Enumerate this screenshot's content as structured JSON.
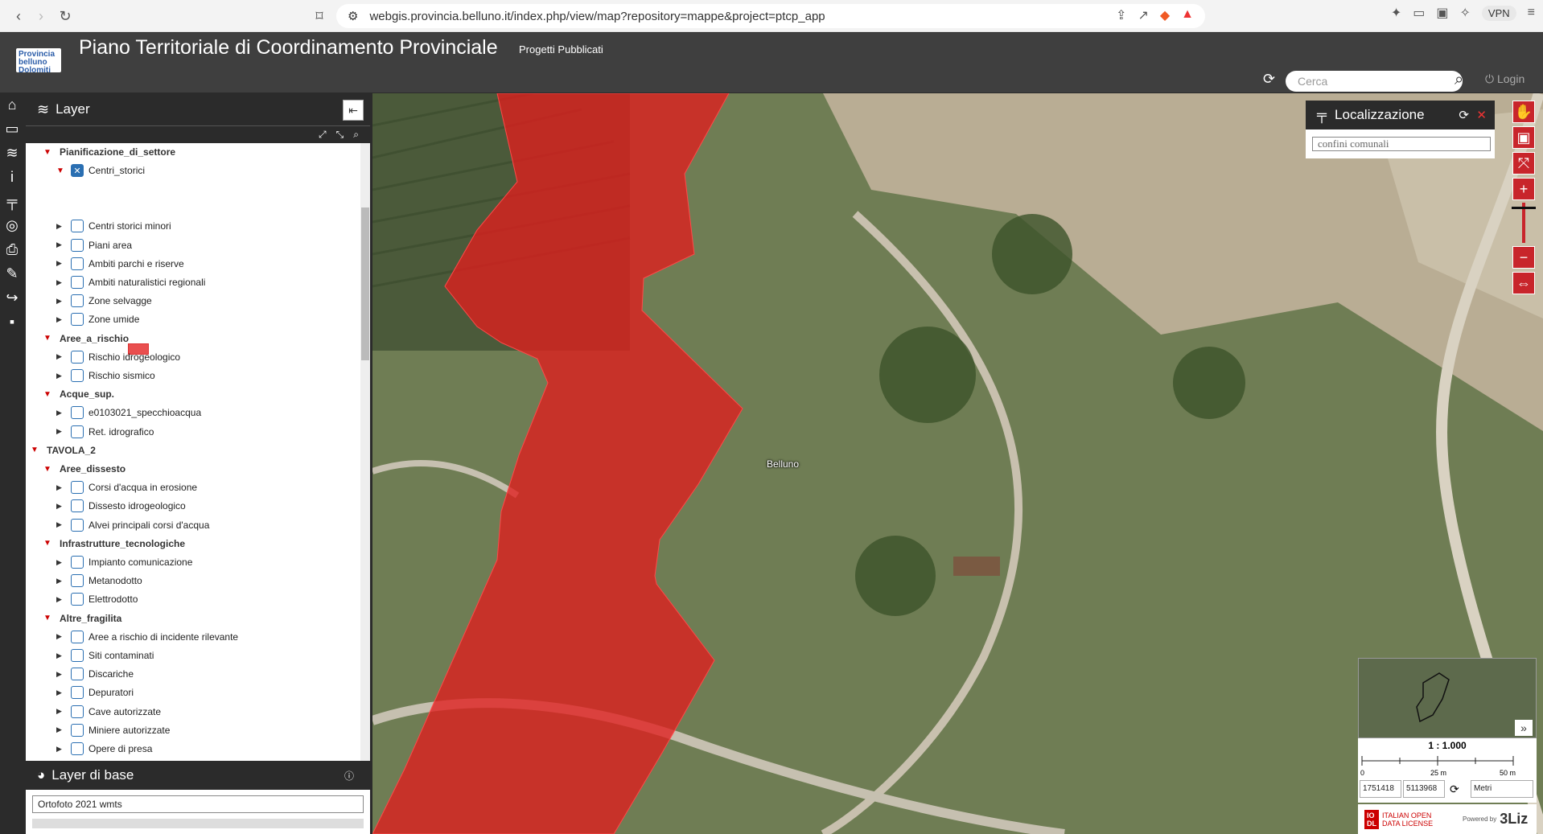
{
  "browser": {
    "url": "webgis.provincia.belluno.it/index.php/view/map?repository=mappe&project=ptcp_app",
    "vpn_label": "VPN"
  },
  "app": {
    "logo_text": "Provincia belluno Dolomiti",
    "title": "Piano Territoriale di Coordinamento Provinciale",
    "subtitle": "Progetti Pubblicati",
    "search_placeholder": "Cerca",
    "login_label": "Login"
  },
  "layer_panel": {
    "title": "Layer",
    "rows": [
      {
        "label": "Pianificazione_di_settore",
        "level": 1,
        "type": "group"
      },
      {
        "label": "Centri_storici",
        "level": 2,
        "type": "layer",
        "checked": true,
        "expanded": true
      },
      {
        "label": "Centri storici minori",
        "level": 2,
        "type": "layer"
      },
      {
        "label": "Piani area",
        "level": 2,
        "type": "layer"
      },
      {
        "label": "Ambiti parchi e riserve",
        "level": 2,
        "type": "layer"
      },
      {
        "label": "Ambiti naturalistici regionali",
        "level": 2,
        "type": "layer"
      },
      {
        "label": "Zone selvagge",
        "level": 2,
        "type": "layer"
      },
      {
        "label": "Zone umide",
        "level": 2,
        "type": "layer"
      },
      {
        "label": "Aree_a_rischio",
        "level": 1,
        "type": "group"
      },
      {
        "label": "Rischio idrogeologico",
        "level": 2,
        "type": "layer"
      },
      {
        "label": "Rischio sismico",
        "level": 2,
        "type": "layer"
      },
      {
        "label": "Acque_sup.",
        "level": 1,
        "type": "group"
      },
      {
        "label": "e0103021_specchioacqua",
        "level": 2,
        "type": "layer"
      },
      {
        "label": "Ret. idrografico",
        "level": 2,
        "type": "layer"
      },
      {
        "label": "TAVOLA_2",
        "level": 0,
        "type": "group"
      },
      {
        "label": "Aree_dissesto",
        "level": 1,
        "type": "group"
      },
      {
        "label": "Corsi d'acqua in erosione",
        "level": 2,
        "type": "layer"
      },
      {
        "label": "Dissesto idrogeologico",
        "level": 2,
        "type": "layer"
      },
      {
        "label": "Alvei principali corsi d'acqua",
        "level": 2,
        "type": "layer"
      },
      {
        "label": "Infrastrutture_tecnologiche",
        "level": 1,
        "type": "group"
      },
      {
        "label": "Impianto comunicazione",
        "level": 2,
        "type": "layer"
      },
      {
        "label": "Metanodotto",
        "level": 2,
        "type": "layer"
      },
      {
        "label": "Elettrodotto",
        "level": 2,
        "type": "layer"
      },
      {
        "label": "Altre_fragilita",
        "level": 1,
        "type": "group"
      },
      {
        "label": "Aree a rischio di incidente rilevante",
        "level": 2,
        "type": "layer"
      },
      {
        "label": "Siti contaminati",
        "level": 2,
        "type": "layer"
      },
      {
        "label": "Discariche",
        "level": 2,
        "type": "layer"
      },
      {
        "label": "Depuratori",
        "level": 2,
        "type": "layer"
      },
      {
        "label": "Cave autorizzate",
        "level": 2,
        "type": "layer"
      },
      {
        "label": "Miniere autorizzate",
        "level": 2,
        "type": "layer"
      },
      {
        "label": "Opere di presa",
        "level": 2,
        "type": "layer"
      }
    ]
  },
  "base_panel": {
    "title": "Layer di base",
    "selected": "Ortofoto 2021 wmts"
  },
  "map": {
    "place_label": "Belluno",
    "highlight_color": "#e01e1e"
  },
  "localizzazione": {
    "title": "Localizzazione",
    "selected": "confini comunali"
  },
  "scale": {
    "ratio": "1 : 1.000",
    "tick_0": "0",
    "tick_mid": "25 m",
    "tick_end": "50 m",
    "coord_x": "1751418",
    "coord_y": "5113968",
    "unit": "Metri"
  },
  "licence": {
    "iodl_text": "ITALIAN OPEN DATA LICENSE",
    "powered": "Powered by",
    "brand": "3Liz"
  }
}
